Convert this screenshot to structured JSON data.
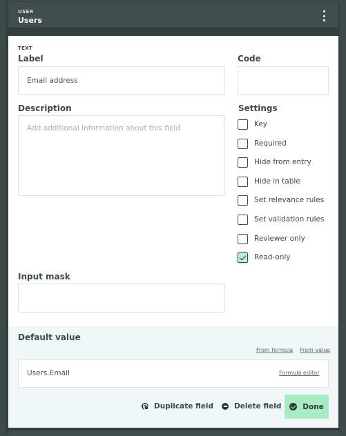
{
  "header": {
    "eyebrow": "USER",
    "title": "Users"
  },
  "field": {
    "type_tag": "TEXT",
    "label_caption": "Label",
    "label_value": "Email address",
    "code_caption": "Code",
    "code_value": "",
    "description_caption": "Description",
    "description_placeholder": "Add additional information about this field",
    "input_mask_caption": "Input mask",
    "input_mask_value": ""
  },
  "settings": {
    "caption": "Settings",
    "items": [
      {
        "label": "Key",
        "checked": false
      },
      {
        "label": "Required",
        "checked": false
      },
      {
        "label": "Hide from entry",
        "checked": false
      },
      {
        "label": "Hide in table",
        "checked": false
      },
      {
        "label": "Set relevance rules",
        "checked": false
      },
      {
        "label": "Set validation rules",
        "checked": false
      },
      {
        "label": "Reviewer only",
        "checked": false
      },
      {
        "label": "Read-only",
        "checked": true
      }
    ]
  },
  "default_value": {
    "caption": "Default value",
    "from_formula": "From formula",
    "from_value": "From value",
    "value": "Users.Email",
    "formula_editor": "Formula editor"
  },
  "actions": {
    "duplicate": "Duplicate field",
    "delete": "Delete field",
    "done": "Done"
  },
  "icons": {
    "menu": "kebab-menu-icon",
    "duplicate": "duplicate-icon",
    "delete": "minus-circle-icon",
    "done": "check-circle-icon"
  },
  "colors": {
    "chrome": "#3d4a48",
    "accent": "#a9ecc3",
    "section_bg": "#f1f6f6"
  }
}
